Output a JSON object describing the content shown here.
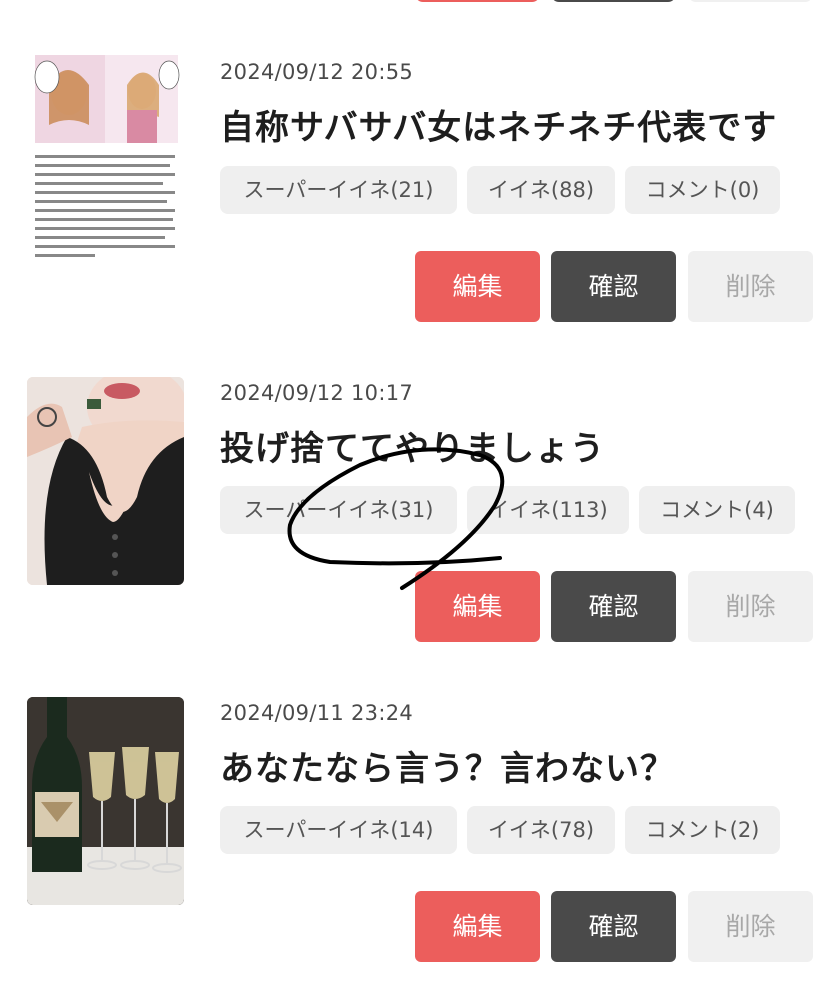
{
  "colors": {
    "edit": "#ec5e5c",
    "check": "#4a4a4a",
    "delete": "#f0f0f0",
    "chip": "#efefef"
  },
  "posts": [
    {
      "date": "2024/09/12 20:55",
      "title": "自称サバサバ女はネチネチ代表です",
      "chips": [
        "スーパーイイネ(21)",
        "イイネ(88)",
        "コメント(0)"
      ],
      "buttons": [
        "編集",
        "確認",
        "削除"
      ]
    },
    {
      "date": "2024/09/12 10:17",
      "title": "投げ捨ててやりましょう",
      "chips": [
        "スーパーイイネ(31)",
        "イイネ(113)",
        "コメント(4)"
      ],
      "buttons": [
        "編集",
        "確認",
        "削除"
      ]
    },
    {
      "date": "2024/09/11 23:24",
      "title": "あなたなら言う？言わない？",
      "chips": [
        "スーパーイイネ(14)",
        "イイネ(78)",
        "コメント(2)"
      ],
      "buttons": [
        "編集",
        "確認",
        "削除"
      ]
    }
  ]
}
